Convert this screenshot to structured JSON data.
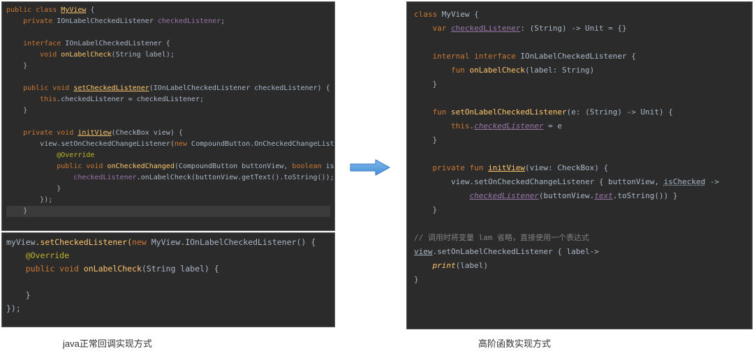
{
  "captions": {
    "left": "java正常回调实现方式",
    "right": "高阶函数实现方式"
  },
  "java_top": {
    "l1_kw1": "public class",
    "l1_cls": "MyView",
    "l1_brace": " {",
    "l2_kw": "private",
    "l2_type": " IOnLabelCheckedListener ",
    "l2_var": "checkedListener",
    "l2_semi": ";",
    "l4_kw": "interface",
    "l4_name": " IOnLabelCheckedListener {",
    "l5_kw": "void",
    "l5_fn": "onLabelCheck",
    "l5_params": "(String label);",
    "l6_brace": "}",
    "l8_kw": "public void",
    "l8_fn": "setCheckedListener",
    "l8_params": "(IOnLabelCheckedListener checkedListener) {",
    "l9_kw": "this",
    "l9_rest": ".checkedListener = checkedListener;",
    "l10_brace": "}",
    "l12_kw": "private void",
    "l12_fn": "initView",
    "l12_params": "(CheckBox view) {",
    "l13_obj": "view",
    "l13_call": ".setOnCheckedChangeListener(",
    "l13_new": "new",
    "l13_type": " CompoundButton.OnCheckedChangeListener() {",
    "l14_ann": "@Override",
    "l15_kw": "public void",
    "l15_fn": "onCheckedChanged",
    "l15_p1": "(CompoundButton buttonView, ",
    "l15_kw2": "boolean",
    "l15_p2": " isChecked) {",
    "l16_obj": "checkedListener",
    "l16_call": ".onLabelCheck(buttonView.getText().toString());",
    "l17_brace": "}",
    "l18_brace": "});",
    "l19_brace": "}"
  },
  "java_bottom": {
    "l1_obj": "myView",
    "l1_call": ".setCheckedListener(",
    "l1_new": "new",
    "l1_type": " MyView.IOnLabelCheckedListener() {",
    "l2_ann": "@Override",
    "l3_kw": "public void",
    "l3_fn": "onLabelCheck",
    "l3_params": "(String label) {",
    "l5_brace": "}",
    "l6_brace": "});"
  },
  "kotlin": {
    "l1_kw": "class",
    "l1_cls": " MyView {",
    "l2_kw": "var",
    "l2_var": "checkedListener",
    "l2_type": ": (String) -> Unit = {}",
    "l4_kw": "internal interface",
    "l4_name": " IOnLabelCheckedListener {",
    "l5_kw": "fun",
    "l5_fn": "onLabelCheck",
    "l5_params": "(label: String)",
    "l6_brace": "}",
    "l8_kw": "fun",
    "l8_fn": "setOnLabelCheckedListener",
    "l8_params": "(e: (String) -> Unit) {",
    "l9_kw": "this",
    "l9_dot": ".",
    "l9_var": "checkedListener",
    "l9_eq": " = e",
    "l10_brace": "}",
    "l12_kw": "private fun",
    "l12_fn": "initView",
    "l12_params": "(view: CheckBox) {",
    "l13_call": "view.setOnCheckedChangeListener { buttonView, ",
    "l13_var": "isChecked",
    "l13_arrow": " ->",
    "l14_fn": "checkedListener",
    "l14_p1": "(buttonView.",
    "l14_prop": "text",
    "l14_p2": ".toString()) }",
    "l15_brace": "}",
    "l17_cmt": "// 调用时将变量 lam 省略，直接使用一个表达式",
    "l18_obj": "view",
    "l18_call": ".setOnLabelCheckedListener { label->",
    "l19_fn": "print",
    "l19_params": "(label)",
    "l20_brace": "}"
  }
}
